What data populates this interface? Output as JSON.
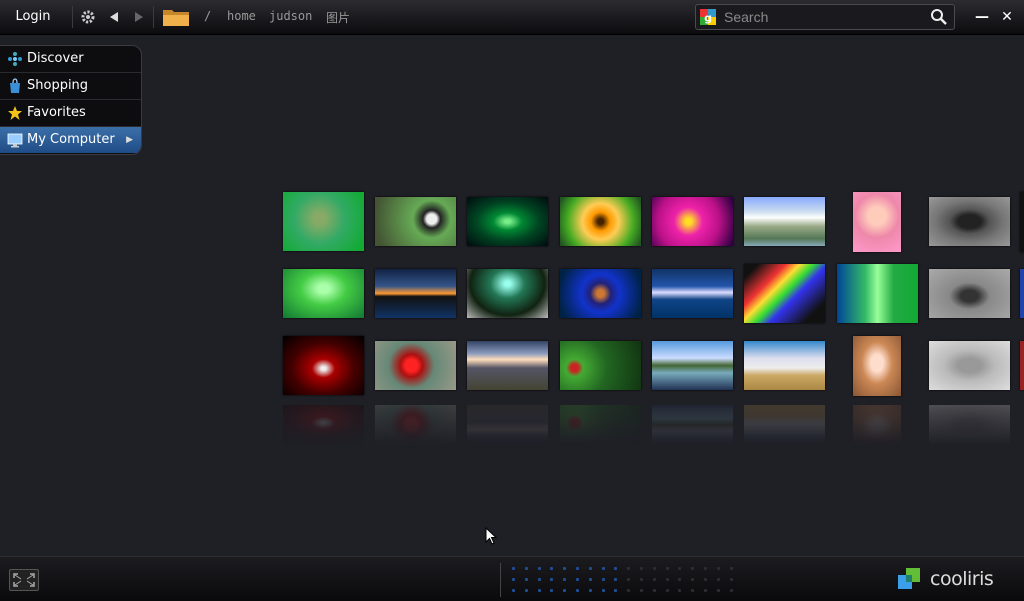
{
  "toolbar": {
    "login_label": "Login",
    "settings_icon": "gear-icon",
    "back_icon": "back-arrow-icon",
    "forward_icon": "forward-arrow-icon",
    "folder_icon": "folder-icon",
    "breadcrumb": [
      "/",
      "home",
      "judson",
      "图片"
    ]
  },
  "search": {
    "placeholder": "Search",
    "value": "",
    "provider_icon": "google-icon",
    "button_icon": "search-icon"
  },
  "window": {
    "minimize_label": "—",
    "close_label": "✕"
  },
  "sidebar": {
    "items": [
      {
        "label": "Discover",
        "icon": "discover-icon",
        "active": false
      },
      {
        "label": "Shopping",
        "icon": "shopping-bag-icon",
        "active": false
      },
      {
        "label": "Favorites",
        "icon": "star-icon",
        "active": false
      },
      {
        "label": "My Computer",
        "icon": "monitor-icon",
        "active": true,
        "arrow": "▶"
      }
    ]
  },
  "gallery": {
    "rows": [
      [
        "frog-on-plant",
        "panda",
        "green-abstract",
        "orange-flower",
        "bee-on-pink-flower",
        "mountain-clouds",
        "portrait-girl",
        "black-car-top"
      ],
      [
        "green-glow",
        "sunset-island",
        "waterfall-stream",
        "blue-orb",
        "blue-lake-mountains",
        "rainbow-streaks",
        "green-aurora",
        "grey-car-front"
      ],
      [
        "carbon-red",
        "red-rose",
        "beach-sunset",
        "ladybug-leaves",
        "reflection-lake",
        "wheat-field-sky",
        "girl-portrait-2",
        "grey-car-side"
      ]
    ]
  },
  "bottombar": {
    "fullscreen_icon": "fullscreen-icon",
    "brand": "cooliris",
    "page_dots_total": 36,
    "page_dots_active": 18
  },
  "colors": {
    "accent": "#2f64a3",
    "background": "#1f1f26",
    "dot_active": "#1e4f96",
    "dot_inactive": "#2c2c33"
  }
}
